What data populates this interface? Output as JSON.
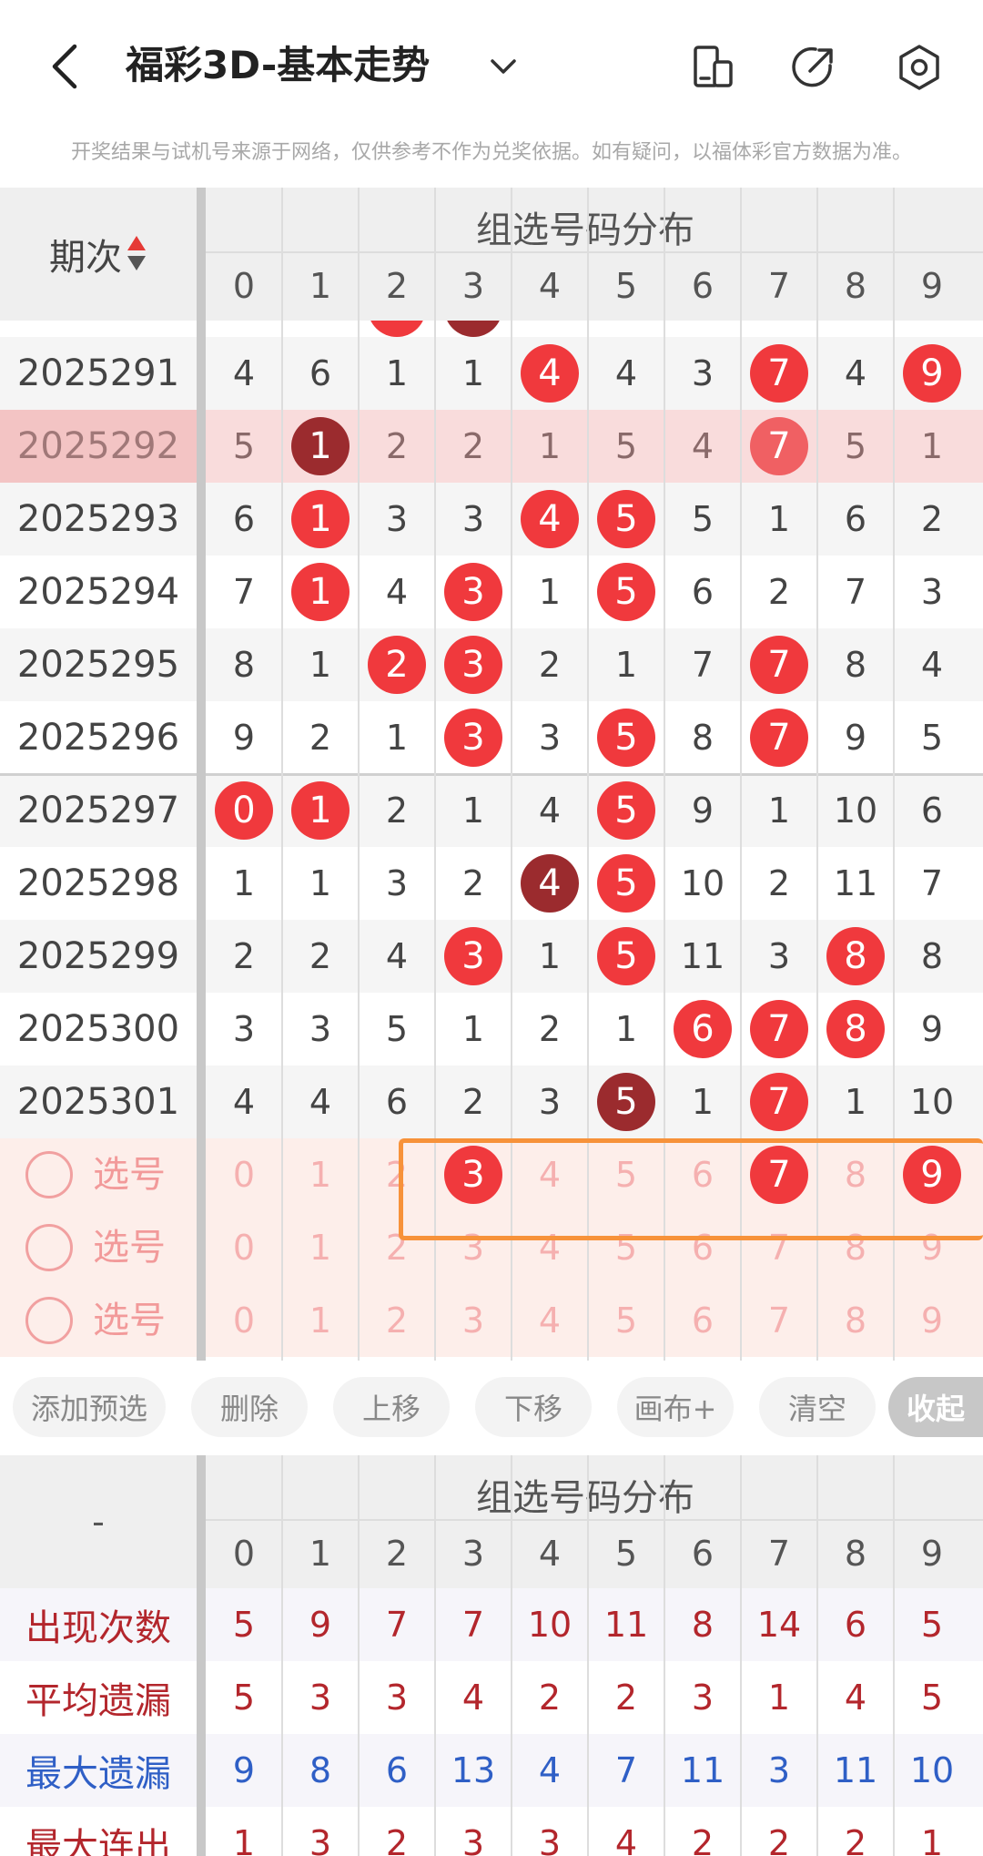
{
  "header": {
    "title": "福彩3D-基本走势",
    "notice": "开奖结果与试机号来源于网络，仅供参考不作为兑奖依据。如有疑问，以福体彩官方数据为准。"
  },
  "grid": {
    "period_label": "期次",
    "section_title": "组选号码分布",
    "digits": [
      "0",
      "1",
      "2",
      "3",
      "4",
      "5",
      "6",
      "7",
      "8",
      "9"
    ],
    "rows": [
      {
        "period": "2025291",
        "highlight": false,
        "cells": [
          {
            "v": "4",
            "b": ""
          },
          {
            "v": "6",
            "b": ""
          },
          {
            "v": "1",
            "b": ""
          },
          {
            "v": "1",
            "b": ""
          },
          {
            "v": "4",
            "b": "red"
          },
          {
            "v": "4",
            "b": ""
          },
          {
            "v": "3",
            "b": ""
          },
          {
            "v": "7",
            "b": "red"
          },
          {
            "v": "4",
            "b": ""
          },
          {
            "v": "9",
            "b": "red"
          }
        ]
      },
      {
        "period": "2025292",
        "highlight": true,
        "cells": [
          {
            "v": "5",
            "b": ""
          },
          {
            "v": "1",
            "b": "dark"
          },
          {
            "v": "2",
            "b": ""
          },
          {
            "v": "2",
            "b": ""
          },
          {
            "v": "1",
            "b": ""
          },
          {
            "v": "5",
            "b": ""
          },
          {
            "v": "4",
            "b": ""
          },
          {
            "v": "7",
            "b": "light"
          },
          {
            "v": "5",
            "b": ""
          },
          {
            "v": "1",
            "b": ""
          }
        ]
      },
      {
        "period": "2025293",
        "highlight": false,
        "cells": [
          {
            "v": "6",
            "b": ""
          },
          {
            "v": "1",
            "b": "red"
          },
          {
            "v": "3",
            "b": ""
          },
          {
            "v": "3",
            "b": ""
          },
          {
            "v": "4",
            "b": "red"
          },
          {
            "v": "5",
            "b": "red"
          },
          {
            "v": "5",
            "b": ""
          },
          {
            "v": "1",
            "b": ""
          },
          {
            "v": "6",
            "b": ""
          },
          {
            "v": "2",
            "b": ""
          }
        ]
      },
      {
        "period": "2025294",
        "highlight": false,
        "cells": [
          {
            "v": "7",
            "b": ""
          },
          {
            "v": "1",
            "b": "red"
          },
          {
            "v": "4",
            "b": ""
          },
          {
            "v": "3",
            "b": "red"
          },
          {
            "v": "1",
            "b": ""
          },
          {
            "v": "5",
            "b": "red"
          },
          {
            "v": "6",
            "b": ""
          },
          {
            "v": "2",
            "b": ""
          },
          {
            "v": "7",
            "b": ""
          },
          {
            "v": "3",
            "b": ""
          }
        ]
      },
      {
        "period": "2025295",
        "highlight": false,
        "cells": [
          {
            "v": "8",
            "b": ""
          },
          {
            "v": "1",
            "b": ""
          },
          {
            "v": "2",
            "b": "red"
          },
          {
            "v": "3",
            "b": "red"
          },
          {
            "v": "2",
            "b": ""
          },
          {
            "v": "1",
            "b": ""
          },
          {
            "v": "7",
            "b": ""
          },
          {
            "v": "7",
            "b": "red"
          },
          {
            "v": "8",
            "b": ""
          },
          {
            "v": "4",
            "b": ""
          }
        ]
      },
      {
        "period": "2025296",
        "highlight": false,
        "cells": [
          {
            "v": "9",
            "b": ""
          },
          {
            "v": "2",
            "b": ""
          },
          {
            "v": "1",
            "b": ""
          },
          {
            "v": "3",
            "b": "red"
          },
          {
            "v": "3",
            "b": ""
          },
          {
            "v": "5",
            "b": "red"
          },
          {
            "v": "8",
            "b": ""
          },
          {
            "v": "7",
            "b": "red"
          },
          {
            "v": "9",
            "b": ""
          },
          {
            "v": "5",
            "b": ""
          }
        ]
      },
      {
        "period": "2025297",
        "highlight": false,
        "cells": [
          {
            "v": "0",
            "b": "red"
          },
          {
            "v": "1",
            "b": "red"
          },
          {
            "v": "2",
            "b": ""
          },
          {
            "v": "1",
            "b": ""
          },
          {
            "v": "4",
            "b": ""
          },
          {
            "v": "5",
            "b": "red"
          },
          {
            "v": "9",
            "b": ""
          },
          {
            "v": "1",
            "b": ""
          },
          {
            "v": "10",
            "b": ""
          },
          {
            "v": "6",
            "b": ""
          }
        ]
      },
      {
        "period": "2025298",
        "highlight": false,
        "cells": [
          {
            "v": "1",
            "b": ""
          },
          {
            "v": "1",
            "b": ""
          },
          {
            "v": "3",
            "b": ""
          },
          {
            "v": "2",
            "b": ""
          },
          {
            "v": "4",
            "b": "dark"
          },
          {
            "v": "5",
            "b": "red"
          },
          {
            "v": "10",
            "b": ""
          },
          {
            "v": "2",
            "b": ""
          },
          {
            "v": "11",
            "b": ""
          },
          {
            "v": "7",
            "b": ""
          }
        ]
      },
      {
        "period": "2025299",
        "highlight": false,
        "cells": [
          {
            "v": "2",
            "b": ""
          },
          {
            "v": "2",
            "b": ""
          },
          {
            "v": "4",
            "b": ""
          },
          {
            "v": "3",
            "b": "red"
          },
          {
            "v": "1",
            "b": ""
          },
          {
            "v": "5",
            "b": "red"
          },
          {
            "v": "11",
            "b": ""
          },
          {
            "v": "3",
            "b": ""
          },
          {
            "v": "8",
            "b": "red"
          },
          {
            "v": "8",
            "b": ""
          }
        ]
      },
      {
        "period": "2025300",
        "highlight": false,
        "cells": [
          {
            "v": "3",
            "b": ""
          },
          {
            "v": "3",
            "b": ""
          },
          {
            "v": "5",
            "b": ""
          },
          {
            "v": "1",
            "b": ""
          },
          {
            "v": "2",
            "b": ""
          },
          {
            "v": "1",
            "b": ""
          },
          {
            "v": "6",
            "b": "red"
          },
          {
            "v": "7",
            "b": "red"
          },
          {
            "v": "8",
            "b": "red"
          },
          {
            "v": "9",
            "b": ""
          }
        ]
      },
      {
        "period": "2025301",
        "highlight": false,
        "cells": [
          {
            "v": "4",
            "b": ""
          },
          {
            "v": "4",
            "b": ""
          },
          {
            "v": "6",
            "b": ""
          },
          {
            "v": "2",
            "b": ""
          },
          {
            "v": "3",
            "b": ""
          },
          {
            "v": "5",
            "b": "dark"
          },
          {
            "v": "1",
            "b": ""
          },
          {
            "v": "7",
            "b": "red"
          },
          {
            "v": "1",
            "b": ""
          },
          {
            "v": "10",
            "b": ""
          }
        ]
      }
    ],
    "selection_rows": [
      {
        "label": "选号",
        "selected": [
          "3",
          "7",
          "9"
        ]
      },
      {
        "label": "选号",
        "selected": []
      },
      {
        "label": "选号",
        "selected": []
      }
    ]
  },
  "buttons": [
    "添加预选",
    "删除",
    "上移",
    "下移",
    "画布+",
    "清空",
    "收起"
  ],
  "stats": {
    "corner": "-",
    "section_title": "组选号码分布",
    "rows": [
      {
        "label": "出现次数",
        "color": "#b3262c",
        "values": [
          "5",
          "9",
          "7",
          "7",
          "10",
          "11",
          "8",
          "14",
          "6",
          "5"
        ]
      },
      {
        "label": "平均遗漏",
        "color": "#b3262c",
        "values": [
          "5",
          "3",
          "3",
          "4",
          "2",
          "2",
          "3",
          "1",
          "4",
          "5"
        ]
      },
      {
        "label": "最大遗漏",
        "color": "#2f5fc6",
        "values": [
          "9",
          "8",
          "6",
          "13",
          "4",
          "7",
          "11",
          "3",
          "11",
          "10"
        ]
      },
      {
        "label": "最大连出",
        "color": "#b3262c",
        "values": [
          "1",
          "3",
          "2",
          "3",
          "3",
          "4",
          "2",
          "2",
          "2",
          "1"
        ]
      }
    ]
  },
  "colors": {
    "ball": "#f0393d",
    "ball_dark": "#9b2b2e",
    "highlight_row": "#f9dcdc",
    "accent_box": "#f7923a"
  }
}
